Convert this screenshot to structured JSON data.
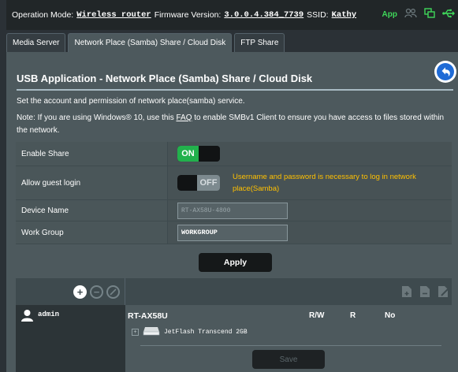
{
  "header": {
    "op_mode_label": "Operation Mode:",
    "op_mode_value": "Wireless router",
    "firmware_label": "Firmware Version:",
    "firmware_value": "3.0.0.4.384_7739",
    "ssid_label": "SSID:",
    "ssid_value": "Kathy",
    "app_label": "App",
    "icons": [
      "user-group-icon",
      "network-status-icon",
      "usb-icon"
    ],
    "colors": {
      "app": "#3fd75a",
      "usb": "#3fd75a"
    }
  },
  "tabs": [
    {
      "label": "Media Server",
      "active": false
    },
    {
      "label": "Network Place (Samba) Share / Cloud Disk",
      "active": true
    },
    {
      "label": "FTP Share",
      "active": false
    }
  ],
  "page": {
    "title": "USB Application - Network Place (Samba) Share / Cloud Disk",
    "description": "Set the account and permission of network place(samba) service.",
    "note_before": "Note: If you are using Windows® 10, use this ",
    "note_link": "FAQ",
    "note_after": " to enable SMBv1 Client to ensure you have access to files stored within the network."
  },
  "settings": {
    "enable_share": {
      "label": "Enable Share",
      "state": "ON"
    },
    "guest_login": {
      "label": "Allow guest login",
      "state": "OFF",
      "note": "Username and password is necessary to log in network place(Samba)"
    },
    "device_name": {
      "label": "Device Name",
      "value": "RT-AX58U-4800"
    },
    "work_group": {
      "label": "Work Group",
      "value": "WORKGROUP"
    }
  },
  "apply_label": "Apply",
  "browser": {
    "account_tools": [
      "add-account-icon",
      "remove-account-icon",
      "edit-account-icon"
    ],
    "folder_tools": [
      "add-folder-icon",
      "delete-folder-icon",
      "edit-folder-icon"
    ],
    "accounts": [
      {
        "name": "admin"
      }
    ],
    "device": "RT-AX58U",
    "columns": [
      "R/W",
      "R",
      "No"
    ],
    "disk": "JetFlash Transcend 2GB",
    "save_label": "Save"
  },
  "colors": {
    "accent_green": "#22b14c",
    "note_yellow": "#ffc000",
    "panel": "#4d595d"
  }
}
